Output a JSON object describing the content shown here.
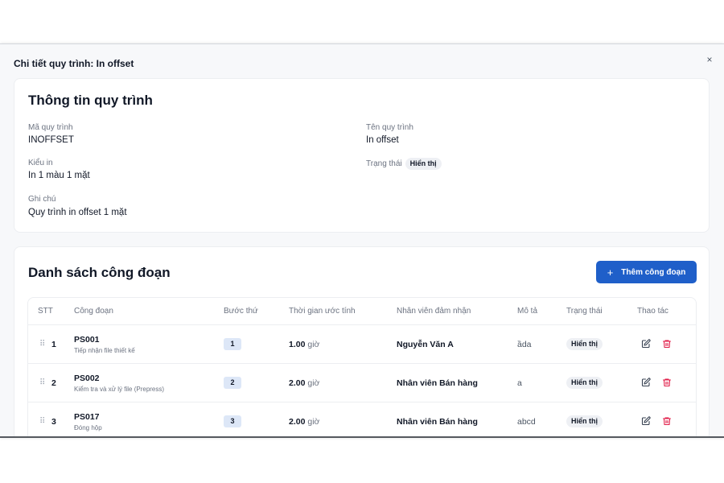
{
  "dialog": {
    "title": "Chi tiết quy trình: In offset",
    "close_label": "×"
  },
  "info": {
    "title": "Thông tin quy trình",
    "code_label": "Mã quy trình",
    "code_value": "INOFFSET",
    "name_label": "Tên quy trình",
    "name_value": "In offset",
    "type_label": "Kiểu in",
    "type_value": "In 1 màu 1 mặt",
    "status_label": "Trạng thái",
    "status_value": "Hiển thị",
    "note_label": "Ghi chú",
    "note_value": "Quy trình in offset 1 mặt"
  },
  "list": {
    "title": "Danh sách công đoạn",
    "add_button_label": "Thêm công đoạn",
    "columns": [
      "STT",
      "Công đoạn",
      "Bước thứ",
      "Thời gian ước tính",
      "Nhân viên đảm nhận",
      "Mô tả",
      "Trạng thái",
      "Thao tác"
    ],
    "rows": [
      {
        "stt": "1",
        "code": "PS001",
        "name": "Tiếp nhận file thiết kế",
        "step": "1",
        "time": "1.00",
        "time_unit": "giờ",
        "staff": "Nguyễn Văn A",
        "desc": "ầda",
        "status": "Hiển thị"
      },
      {
        "stt": "2",
        "code": "PS002",
        "name": "Kiểm tra và xử lý file (Prepress)",
        "step": "2",
        "time": "2.00",
        "time_unit": "giờ",
        "staff": "Nhân viên Bán hàng",
        "desc": "a",
        "status": "Hiển thị"
      },
      {
        "stt": "3",
        "code": "PS017",
        "name": "Đóng hộp",
        "step": "3",
        "time": "2.00",
        "time_unit": "giờ",
        "staff": "Nhân viên Bán hàng",
        "desc": "abcd",
        "status": "Hiển thị"
      }
    ]
  },
  "icons": {
    "drag": "drag-handle-icon",
    "edit": "edit-icon",
    "delete": "trash-icon",
    "add": "plus-icon"
  },
  "colors": {
    "primary": "#1f5fc9",
    "danger": "#e11d48",
    "step_badge": "#dde7f7"
  }
}
